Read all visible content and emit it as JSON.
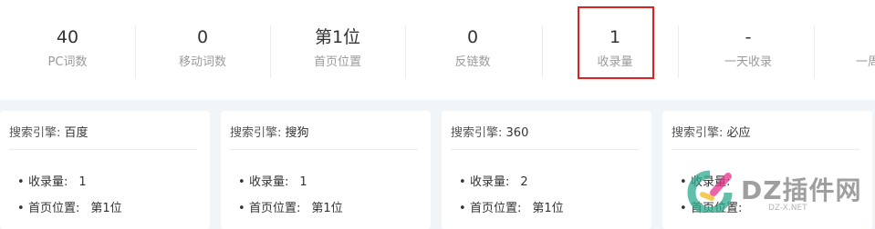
{
  "stats": [
    {
      "value": "40",
      "label": "PC词数"
    },
    {
      "value": "0",
      "label": "移动词数"
    },
    {
      "value": "第1位",
      "label": "首页位置"
    },
    {
      "value": "0",
      "label": "反链数"
    },
    {
      "value": "1",
      "label": "收录量"
    },
    {
      "value": "-",
      "label": "一天收录"
    },
    {
      "value": "",
      "label": "一周"
    }
  ],
  "highlight_color": "#e0201b",
  "engine_key": "搜索引擎:",
  "cards": [
    {
      "engine": "百度",
      "rows": [
        {
          "k": "收录量:",
          "v": "1"
        },
        {
          "k": "首页位置:",
          "v": "第1位"
        }
      ]
    },
    {
      "engine": "搜狗",
      "rows": [
        {
          "k": "收录量:",
          "v": "1"
        },
        {
          "k": "首页位置:",
          "v": "第1位"
        }
      ]
    },
    {
      "engine": "360",
      "rows": [
        {
          "k": "收录量:",
          "v": "2"
        },
        {
          "k": "首页位置:",
          "v": "第1位"
        }
      ]
    },
    {
      "engine": "必应",
      "rows": [
        {
          "k": "收录量:",
          "v": ""
        },
        {
          "k": "首页位置:",
          "v": ""
        }
      ]
    }
  ],
  "watermark": {
    "text": "DZ插件网",
    "sub": "DZ-X.NET"
  }
}
